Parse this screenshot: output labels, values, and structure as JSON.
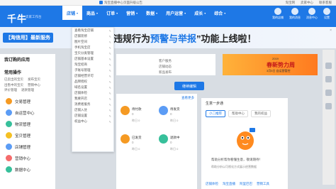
{
  "topstrip": {
    "notice": "淘宝直播中心页面升级公告",
    "links": [
      "淘宝网",
      "卖家中心",
      "联系客服"
    ]
  },
  "nav": {
    "logo": "千牛",
    "sublogo": "卖家工作台",
    "menu": [
      {
        "label": "店铺",
        "active": true
      },
      {
        "label": "商品",
        "active": false
      },
      {
        "label": "订单",
        "active": false
      },
      {
        "label": "营销",
        "active": false
      },
      {
        "label": "数据",
        "active": false
      },
      {
        "label": "用户运营",
        "active": false
      },
      {
        "label": "成长",
        "active": false
      },
      {
        "label": "综合",
        "active": false
      }
    ],
    "right_icons": [
      "我的店铺",
      "我的消息",
      "消息中心",
      "设置"
    ]
  },
  "banner": {
    "tag": "【淘信用】最新服务",
    "headline_pre": "违规行为",
    "headline_hl": "预警与举报",
    "headline_post": "”功能上线啦！",
    "close": "×"
  },
  "dropdown": {
    "items": [
      "查看淘宝店铺",
      "店铺装修",
      "图片空间",
      "手机淘宝店",
      "宝贝分类管理",
      "店铺基本设置",
      "淘宝招商",
      "子账号管理",
      "店铺经营许可",
      "品牌授权",
      "域名设置",
      "店铺体检",
      "我要开店",
      "消费者服务",
      "店铺入驻",
      "店铺设置",
      "权益中心"
    ]
  },
  "sidebar": {
    "block1_title": "我订购的应用",
    "block2_title": "常用操作",
    "links_row1": [
      "已卖出的宝贝",
      "发布宝贝"
    ],
    "links_row2": [
      "出售中的宝贝",
      "营销中心"
    ],
    "links_row3": [
      "评价管理",
      "退款管理"
    ],
    "items": [
      {
        "label": "交易管理",
        "color": "#f59a23"
      },
      {
        "label": "自运营中心",
        "color": "#5b9cf5"
      },
      {
        "label": "物流管理",
        "color": "#37c09b"
      },
      {
        "label": "宝贝管理",
        "color": "#f5c023"
      },
      {
        "label": "店铺管理",
        "color": "#5b9cf5"
      },
      {
        "label": "营销中心",
        "color": "#f56c6c"
      },
      {
        "label": "数据中心",
        "color": "#37c09b"
      }
    ]
  },
  "greet": {
    "line1": "客户服务",
    "line2": "店铺动态",
    "line3": "新品发布"
  },
  "ad": {
    "year": "2019",
    "big": "春新势力周",
    "sub": "3月5日 自运营管控"
  },
  "stats": {
    "header": "查看更多",
    "cells": [
      {
        "label": "待付款",
        "num": "0",
        "sub": "昨日 0",
        "color": "#f59a23"
      },
      {
        "label": "待发货",
        "num": "0",
        "sub": "昨日 0",
        "color": "#5b9cf5"
      },
      {
        "label": "已发货",
        "num": "0",
        "sub": "昨日 0",
        "color": "#f59a23"
      },
      {
        "label": "退款中",
        "num": "0",
        "sub": "昨日 0",
        "color": "#37c09b"
      }
    ]
  },
  "update_button": "继续编辑",
  "right_panel": {
    "title": "生意一步通",
    "tabs": [
      {
        "label": "小二推荐",
        "active": true
      },
      {
        "label": "帮助中心",
        "active": false
      },
      {
        "label": "我的权益",
        "active": false
      }
    ],
    "message": "帮助分析帮你看懂生意，敬请期待！",
    "message2": "帮助分析以可视化方式展示经营数据",
    "links": [
      "店铺体检",
      "淘宝直播",
      "阿里巴巴",
      "营销工具"
    ]
  }
}
